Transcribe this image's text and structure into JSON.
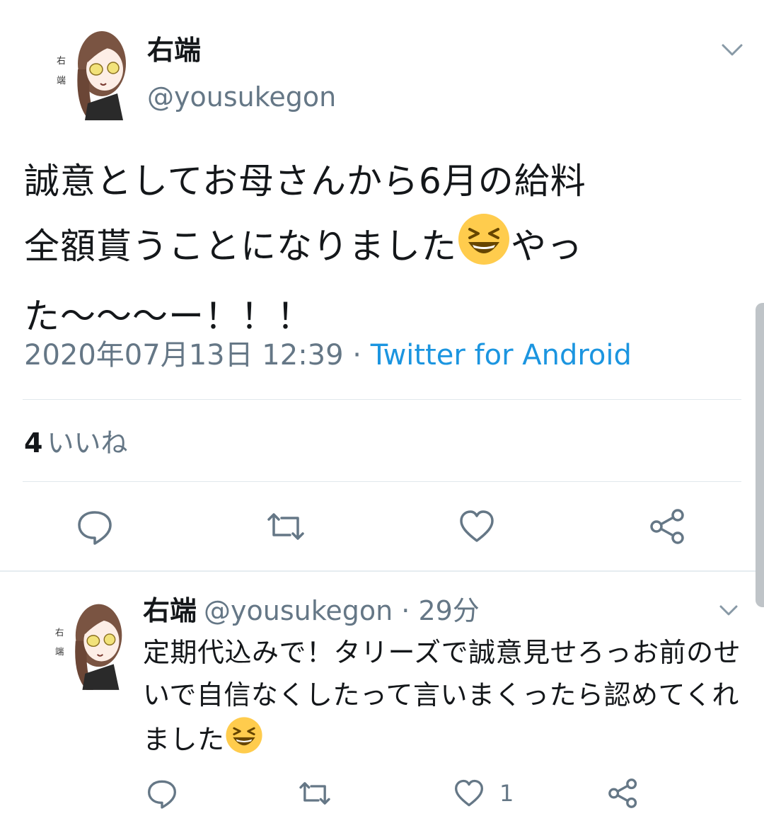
{
  "tweet": {
    "author_name": "右端",
    "author_handle": "@yousukegon",
    "avatar_caption": "右端",
    "text_line1": "誠意としてお母さんから6月の給料",
    "text_line2": "全額貰うことになりました",
    "text_line2_tail": "やっ",
    "text_line3": "た〜〜〜ー！！！",
    "emoji": "grinning-squinting-face",
    "date": "2020年07月13日 12:39",
    "separator": " · ",
    "source": "Twitter for Android",
    "like_count": "4",
    "like_label": "いいね"
  },
  "reply": {
    "author_name": "右端",
    "author_handle": "@yousukegon",
    "separator": " · ",
    "time": "29分",
    "text": "定期代込みで！タリーズで誠意見せろっお前のせいで自信なくしたって言いまくったら認めてくれました",
    "like_count": "1"
  },
  "icons": {
    "reply": "speech-bubble-icon",
    "retweet": "retweet-icon",
    "like": "heart-icon",
    "share": "share-icon",
    "menu": "chevron-down-icon"
  },
  "colors": {
    "text": "#14171a",
    "secondary": "#657786",
    "link": "#1b95e0",
    "divider": "#e1e8ed",
    "emoji": "#ffcc4d"
  }
}
